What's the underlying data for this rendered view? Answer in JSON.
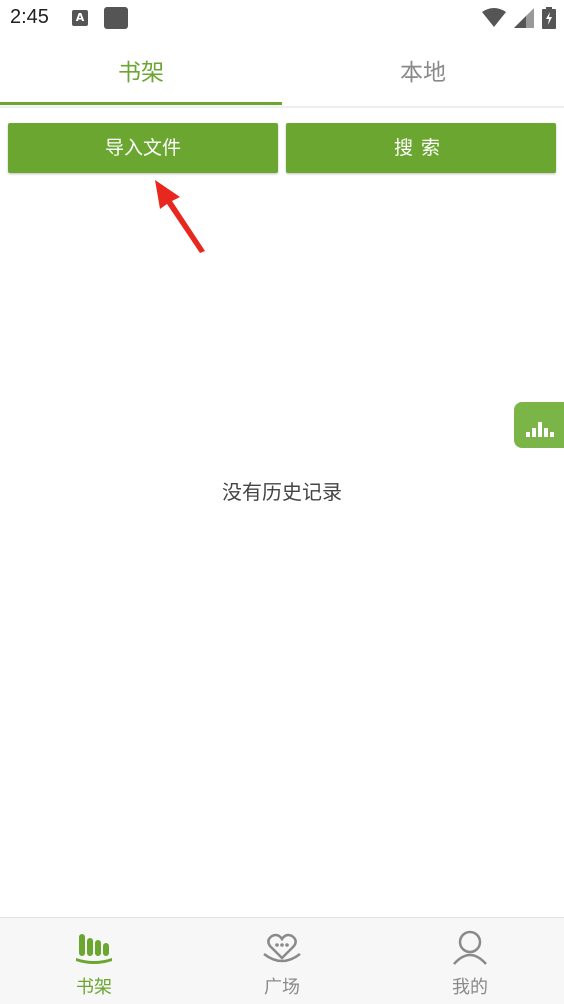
{
  "status_bar": {
    "time": "2:45",
    "notif_a": "A"
  },
  "tabs": [
    {
      "label": "书架",
      "active": true
    },
    {
      "label": "本地",
      "active": false
    }
  ],
  "actions": {
    "import_label": "导入文件",
    "search_label": "搜索"
  },
  "floating_button": {
    "icon": "chart-icon"
  },
  "empty_state": {
    "text": "没有历史记录"
  },
  "bottom_nav": [
    {
      "label": "书架",
      "icon": "bookshelf-icon",
      "active": true
    },
    {
      "label": "广场",
      "icon": "plaza-icon",
      "active": false
    },
    {
      "label": "我的",
      "icon": "profile-icon",
      "active": false
    }
  ],
  "colors": {
    "accent": "#6aa630",
    "inactive": "#8a8a8a",
    "arrow": "#e8281e"
  }
}
